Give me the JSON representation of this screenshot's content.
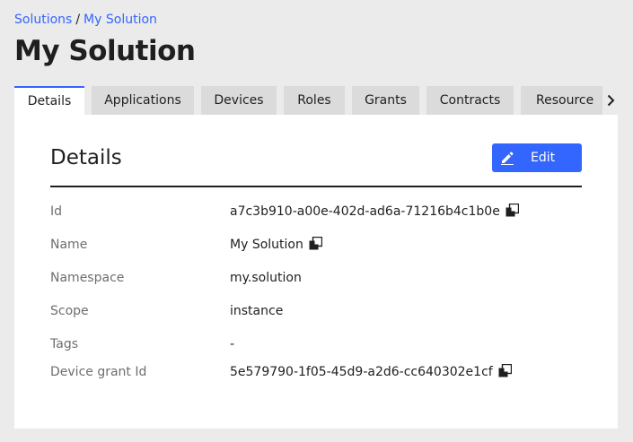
{
  "breadcrumb": {
    "root": "Solutions",
    "separator": "/",
    "current": "My Solution"
  },
  "page_title": "My Solution",
  "tabs": [
    {
      "label": "Details"
    },
    {
      "label": "Applications"
    },
    {
      "label": "Devices"
    },
    {
      "label": "Roles"
    },
    {
      "label": "Grants"
    },
    {
      "label": "Contracts"
    },
    {
      "label": "Resource"
    }
  ],
  "details": {
    "title": "Details",
    "edit_label": "Edit",
    "fields": {
      "id": {
        "key": "Id",
        "value": "a7c3b910-a00e-402d-ad6a-71216b4c1b0e"
      },
      "name": {
        "key": "Name",
        "value": "My Solution"
      },
      "namespace": {
        "key": "Namespace",
        "value": "my.solution"
      },
      "scope": {
        "key": "Scope",
        "value": "instance"
      },
      "tags": {
        "key": "Tags",
        "value": "-"
      },
      "device_grant_id": {
        "key": "Device grant Id",
        "value": "5e579790-1f05-45d9-a2d6-cc640302e1cf"
      }
    }
  },
  "colors": {
    "accent": "#3366ff",
    "background": "#ebebeb",
    "panel": "#ffffff",
    "tab_inactive": "#dbdbdb"
  },
  "icons": {
    "edit": "pencil-icon",
    "copy": "copy-icon",
    "tabs_next": "chevron-right-icon"
  }
}
